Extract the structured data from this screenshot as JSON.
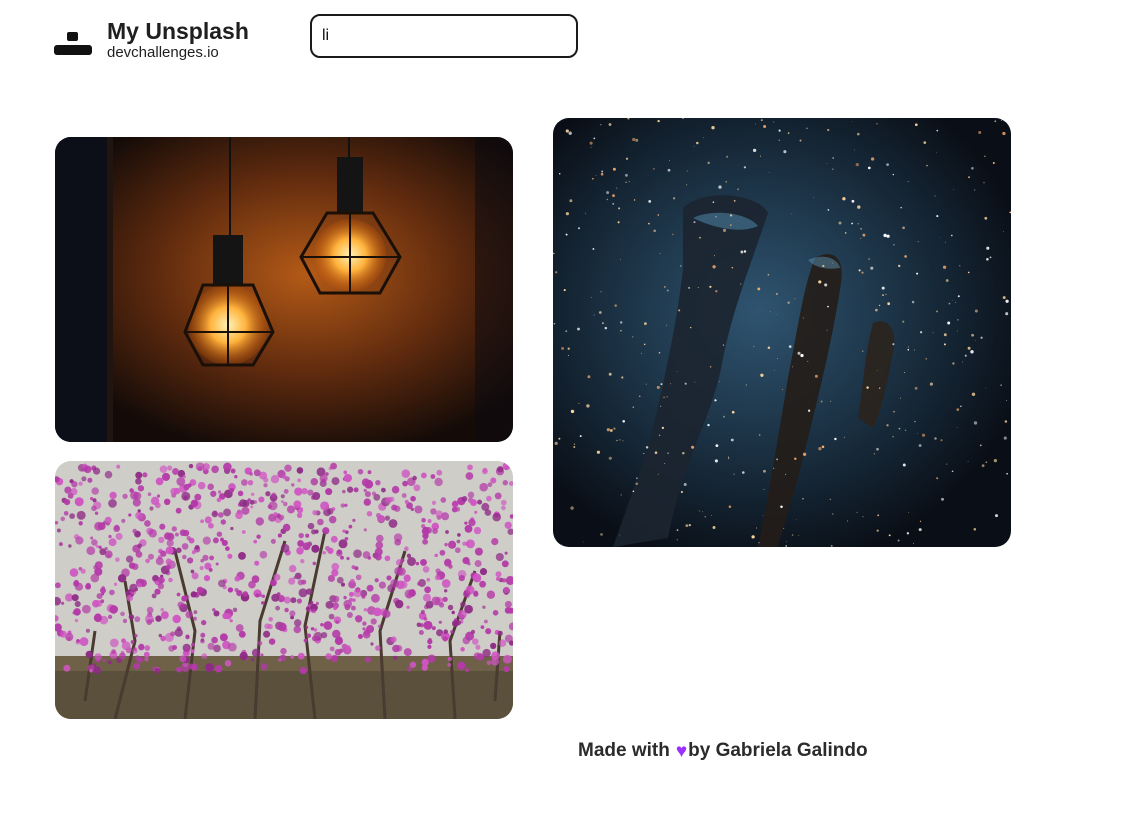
{
  "header": {
    "logo_icon": "user-icon",
    "title": "My Unsplash",
    "subtitle": "devchallenges.io"
  },
  "search": {
    "value": "li",
    "placeholder": ""
  },
  "gallery": {
    "photos": [
      {
        "subject": "lamps",
        "accent": "#f39a2b"
      },
      {
        "subject": "space",
        "accent": "#3b5f7d"
      },
      {
        "subject": "tree",
        "accent": "#b53fb0"
      }
    ]
  },
  "footer": {
    "made_with": "Made with",
    "heart_icon": "heart-icon",
    "heart_color": "#9b30ff",
    "by": "by Gabriela Galindo"
  }
}
